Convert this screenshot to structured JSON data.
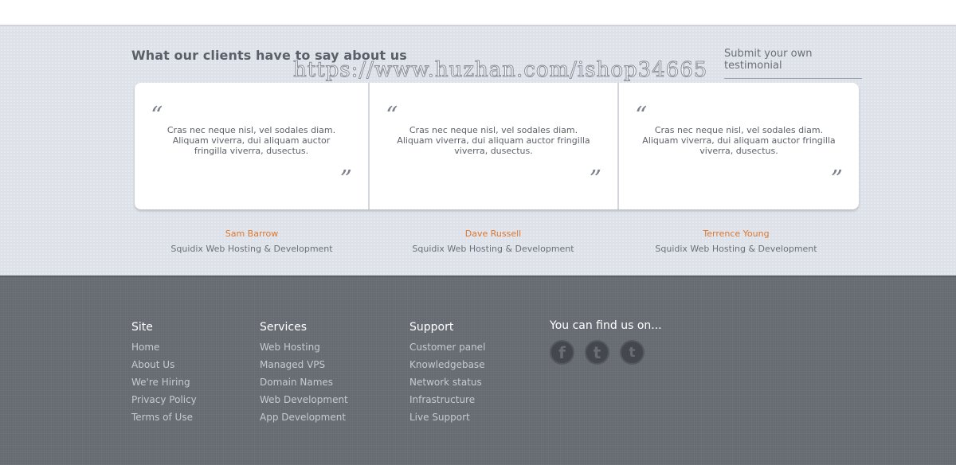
{
  "testimonials": {
    "title": "What our clients have to say about us",
    "submit_label": "Submit your own testimonial",
    "watermark": "https://www.huzhan.com/ishop34665",
    "quote_open": "“",
    "quote_close": "”",
    "items": [
      {
        "text": "Cras nec neque nisl, vel sodales diam. Aliquam viverra, dui aliquam auctor fringilla viverra, dusectus.",
        "name": "Sam Barrow",
        "company": "Squidix Web Hosting & Development"
      },
      {
        "text": "Cras nec neque nisl, vel sodales diam. Aliquam viverra, dui aliquam auctor fringilla viverra, dusectus.",
        "name": "Dave Russell",
        "company": "Squidix Web Hosting & Development"
      },
      {
        "text": "Cras nec neque nisl, vel sodales diam. Aliquam viverra, dui aliquam auctor fringilla viverra, dusectus.",
        "name": "Terrence Young",
        "company": "Squidix Web Hosting & Development"
      }
    ]
  },
  "footer": {
    "site": {
      "heading": "Site",
      "links": [
        "Home",
        "About Us",
        "We're Hiring",
        "Privacy Policy",
        "Terms of Use"
      ]
    },
    "services": {
      "heading": "Services",
      "links": [
        "Web Hosting",
        "Managed VPS",
        "Domain Names",
        "Web Development",
        "App Development"
      ]
    },
    "support": {
      "heading": "Support",
      "links": [
        "Customer panel",
        "Knowledgebase",
        "Network status",
        "Infrastructure",
        "Live Support"
      ]
    },
    "social": {
      "heading": "You can find us on...",
      "icons": [
        {
          "name": "facebook-icon",
          "glyph": "f"
        },
        {
          "name": "tumblr-icon",
          "glyph": "t"
        },
        {
          "name": "twitter-icon",
          "glyph": "t"
        }
      ]
    }
  },
  "colors": {
    "accent": "#e0762b",
    "footer_bg": "#666b73",
    "testimonial_bg": "#dde2ea"
  }
}
